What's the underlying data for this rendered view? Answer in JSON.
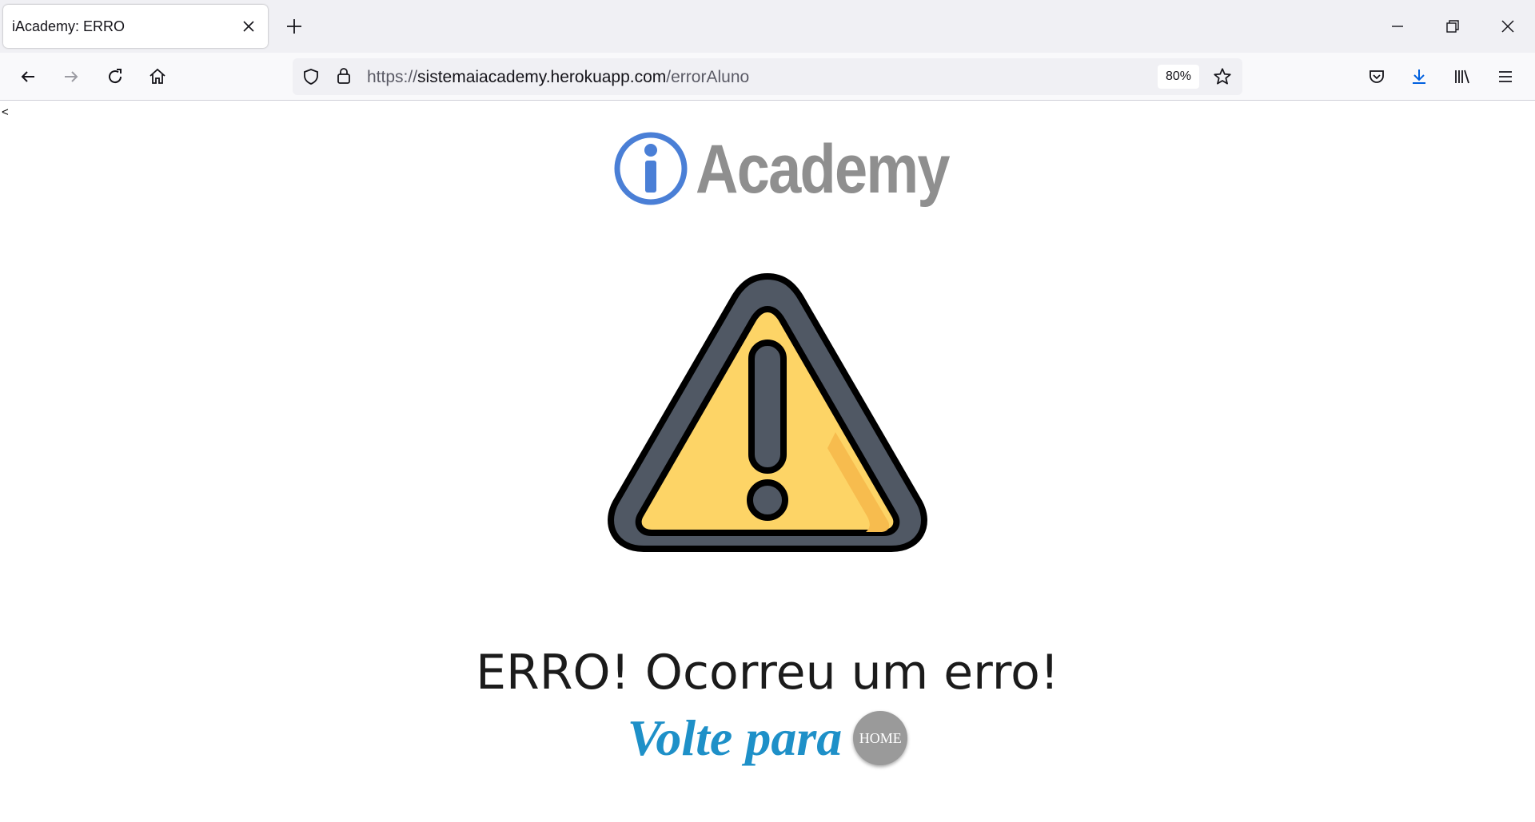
{
  "browser": {
    "tab_title": "iAcademy: ERRO",
    "url_scheme": "https://",
    "url_host": "sistemaiacademy.herokuapp.com",
    "url_path": "/errorAluno",
    "zoom": "80%"
  },
  "page": {
    "stray_char": "<",
    "logo_text": "Academy",
    "error_title": "ERRO! Ocorreu um erro!",
    "back_text": "Volte para",
    "home_button": "HOME"
  },
  "colors": {
    "logo_blue": "#4a7fd6",
    "logo_gray": "#8f8f8f",
    "warning_fill": "#fdd466",
    "warning_stroke": "#505864",
    "link_blue": "#1e90c8",
    "home_bg": "#9a9a9a"
  },
  "icons": [
    "close-icon",
    "plus-icon",
    "minimize-icon",
    "restore-icon",
    "back-icon",
    "forward-icon",
    "reload-icon",
    "home-icon",
    "shield-icon",
    "lock-icon",
    "star-icon",
    "pocket-icon",
    "download-icon",
    "library-icon",
    "menu-icon",
    "warning-icon",
    "info-icon"
  ]
}
